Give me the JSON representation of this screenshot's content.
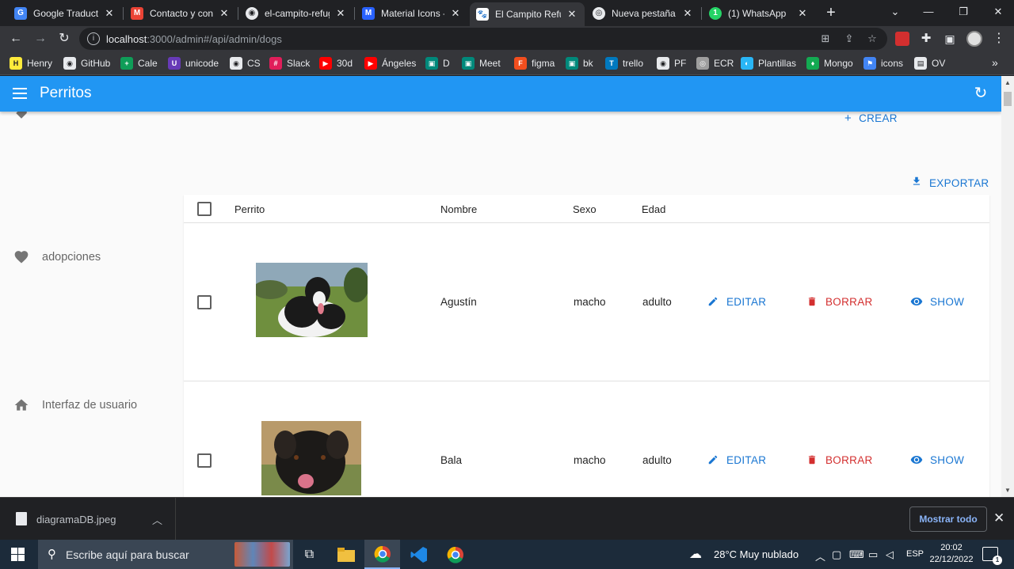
{
  "browser": {
    "tabs": [
      {
        "title": "Google Traductor",
        "favicon_color": "#4285f4",
        "favicon_glyph": "G"
      },
      {
        "title": "Contacto y consu",
        "favicon_color": "#ea4335",
        "favicon_glyph": "M"
      },
      {
        "title": "el-campito-refug",
        "favicon_color": "#e8eaed",
        "favicon_glyph": "◉"
      },
      {
        "title": "Material Icons - M",
        "favicon_color": "#2962ff",
        "favicon_glyph": "M"
      },
      {
        "title": "El Campito Refug",
        "favicon_color": "#ffffff",
        "favicon_glyph": "🐾"
      },
      {
        "title": "Nueva pestaña",
        "favicon_color": "#e8eaed",
        "favicon_glyph": "◎"
      },
      {
        "title": "(1) WhatsApp",
        "favicon_color": "#25d366",
        "favicon_glyph": "1"
      }
    ],
    "active_tab_index": 4,
    "url_host": "localhost",
    "url_path": ":3000/admin#/api/admin/dogs",
    "bookmarks": [
      {
        "label": "Henry",
        "color": "#ffeb3b",
        "glyph": "H"
      },
      {
        "label": "GitHub",
        "color": "#e8eaed",
        "glyph": "◉"
      },
      {
        "label": "Cale",
        "color": "#0f9d58",
        "glyph": "+"
      },
      {
        "label": "unicode",
        "color": "#673ab7",
        "glyph": "U"
      },
      {
        "label": "CS",
        "color": "#e8eaed",
        "glyph": "◉"
      },
      {
        "label": "Slack",
        "color": "#e01e5a",
        "glyph": "#"
      },
      {
        "label": "30d",
        "color": "#ff0000",
        "glyph": "▶"
      },
      {
        "label": "Ángeles",
        "color": "#ff0000",
        "glyph": "▶"
      },
      {
        "label": "D",
        "color": "#00897b",
        "glyph": "▣"
      },
      {
        "label": "Meet",
        "color": "#00897b",
        "glyph": "▣"
      },
      {
        "label": "figma",
        "color": "#f24e1e",
        "glyph": "F"
      },
      {
        "label": "bk",
        "color": "#00897b",
        "glyph": "▣"
      },
      {
        "label": "trello",
        "color": "#0079bf",
        "glyph": "T"
      },
      {
        "label": "PF",
        "color": "#e8eaed",
        "glyph": "◉"
      },
      {
        "label": "ECR",
        "color": "#9e9e9e",
        "glyph": "◎"
      },
      {
        "label": "Plantillas",
        "color": "#29b6f6",
        "glyph": "◐"
      },
      {
        "label": "Mongo",
        "color": "#13aa52",
        "glyph": "♦"
      },
      {
        "label": "icons",
        "color": "#4285f4",
        "glyph": "⚑"
      },
      {
        "label": "OV",
        "color": "#e8eaed",
        "glyph": "▤"
      }
    ],
    "bookmarks_more": "»"
  },
  "app": {
    "title": "Perritos",
    "sidebar": [
      {
        "label": "adopciones",
        "icon": "heart-icon"
      },
      {
        "label": "Interfaz de usuario",
        "icon": "home-icon"
      }
    ],
    "create_label": "CREAR",
    "export_label": "EXPORTAR",
    "columns": [
      "Perrito",
      "Nombre",
      "Sexo",
      "Edad"
    ],
    "rows": [
      {
        "nombre": "Agustín",
        "sexo": "macho",
        "edad": "adulto"
      },
      {
        "nombre": "Bala",
        "sexo": "macho",
        "edad": "adulto"
      }
    ],
    "edit_label": "EDITAR",
    "delete_label": "BORRAR",
    "show_label": "SHOW"
  },
  "downloads": {
    "file": "diagramaDB.jpeg",
    "show_all": "Mostrar todo"
  },
  "taskbar": {
    "search_placeholder": "Escribe aquí para buscar",
    "weather": "28°C  Muy nublado",
    "lang": "ESP",
    "time": "20:02",
    "date": "22/12/2022",
    "notifications": "1"
  }
}
